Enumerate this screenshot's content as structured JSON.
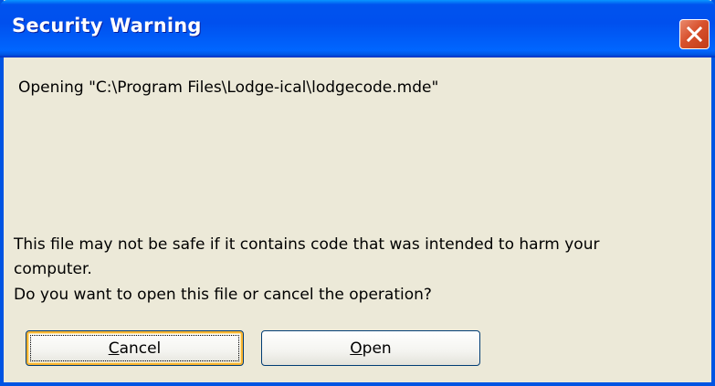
{
  "window": {
    "title": "Security Warning"
  },
  "titlebar": {
    "close_icon": "close-icon"
  },
  "message": {
    "opening_line": "Opening \"C:\\Program Files\\Lodge-ical\\lodgecode.mde\"",
    "warning_line1": "This file may not be safe if it contains code that was intended to harm your",
    "warning_line2": "computer.",
    "question_line": "Do you want to open this file or cancel the operation?"
  },
  "buttons": {
    "cancel": {
      "accel": "C",
      "rest": "ancel"
    },
    "open": {
      "accel": "O",
      "rest": "pen"
    }
  },
  "colors": {
    "titlebar_blue": "#0054e3",
    "dialog_background": "#ece9d8",
    "close_red": "#d8512d",
    "default_button_highlight": "#f8b330"
  }
}
